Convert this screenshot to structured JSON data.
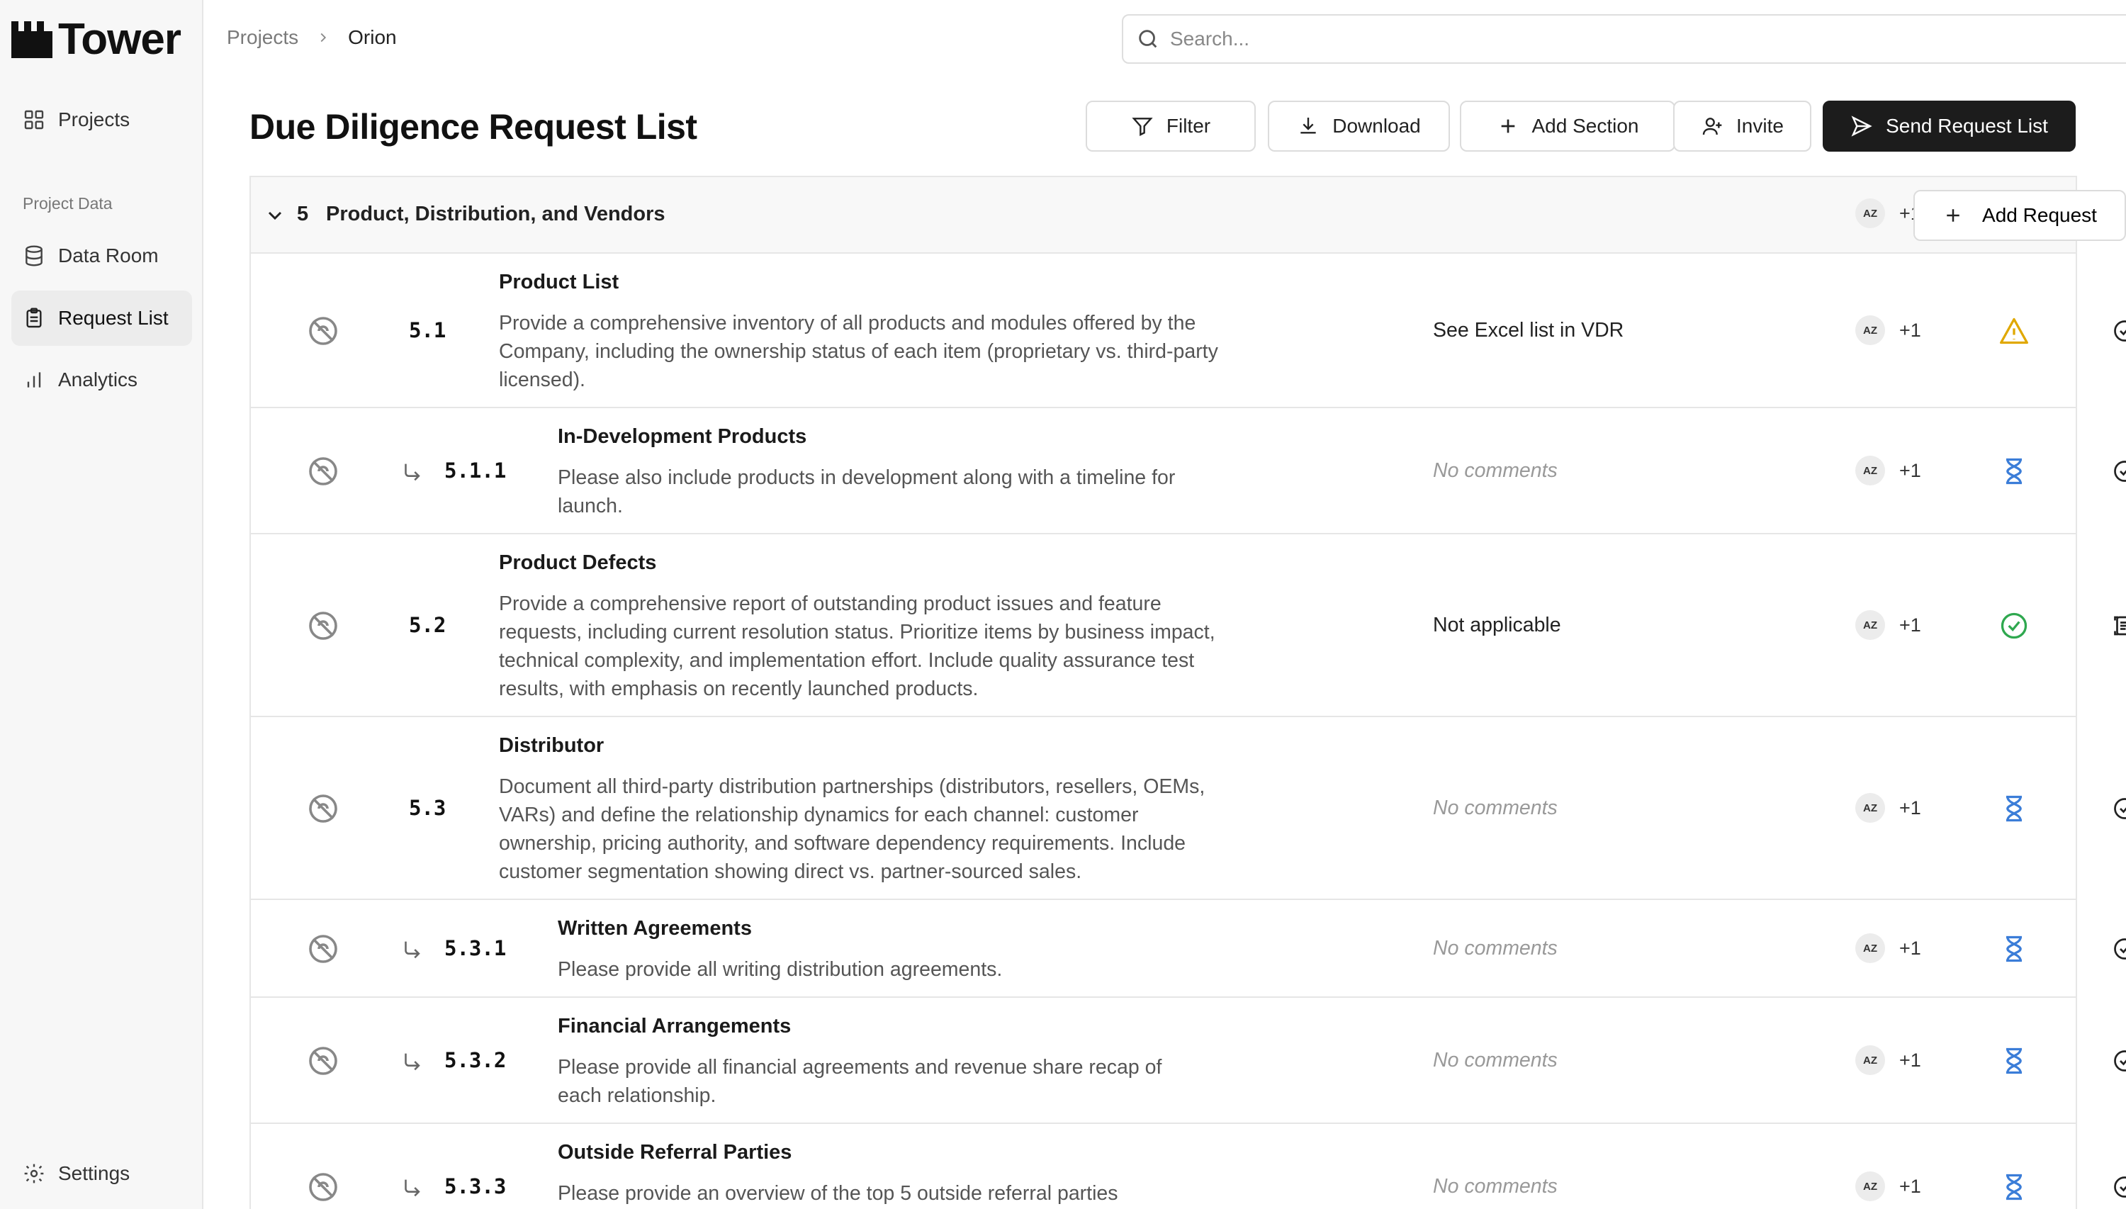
{
  "app": {
    "name": "Tower"
  },
  "sidebar": {
    "items": [
      {
        "label": "Projects",
        "icon": "grid-icon"
      },
      {
        "label": "Data Room",
        "icon": "database-icon"
      },
      {
        "label": "Request List",
        "icon": "clipboard-icon",
        "active": true
      },
      {
        "label": "Analytics",
        "icon": "bar-chart-icon"
      }
    ],
    "section_label": "Project Data",
    "settings_label": "Settings"
  },
  "breadcrumb": {
    "parent": "Projects",
    "current": "Orion"
  },
  "search": {
    "placeholder": "Search..."
  },
  "user": {
    "initials": "AZ"
  },
  "page": {
    "title": "Due Diligence Request List",
    "buttons": {
      "filter": "Filter",
      "download": "Download",
      "add_section": "Add Section",
      "invite": "Invite",
      "send": "Send Request List"
    }
  },
  "section": {
    "number": "5",
    "title": "Product, Distribution, and Vendors",
    "assignee_initials": "AZ",
    "assignee_more": "+1",
    "add_request_label": "Add Request"
  },
  "requests": [
    {
      "id": "5.1",
      "sub": false,
      "title": "Product List",
      "desc": "Provide a comprehensive inventory of all products and modules offered by the Company, including the ownership status of each item (proprietary vs. third-party licensed).",
      "comment": "See Excel list in VDR",
      "has_comment": true,
      "status": "warning",
      "action_icon": "check-circle-icon",
      "assignee": "AZ",
      "more": "+1"
    },
    {
      "id": "5.1.1",
      "sub": true,
      "title": "In-Development Products",
      "desc": "Please also include products in development along with a timeline for launch.",
      "comment": "No comments",
      "has_comment": false,
      "status": "pending",
      "action_icon": "check-circle-icon",
      "assignee": "AZ",
      "more": "+1"
    },
    {
      "id": "5.2",
      "sub": false,
      "title": "Product Defects",
      "desc": "Provide a comprehensive report of outstanding product issues and feature requests, including current resolution status. Prioritize items by business impact, technical complexity, and implementation effort. Include quality assurance test results, with emphasis on recently launched products.",
      "comment": "Not applicable",
      "has_comment": true,
      "status": "complete",
      "action_icon": "document-scan-icon",
      "assignee": "AZ",
      "more": "+1"
    },
    {
      "id": "5.3",
      "sub": false,
      "title": "Distributor",
      "desc": "Document all third-party distribution partnerships (distributors, resellers, OEMs, VARs) and define the relationship dynamics for each channel: customer ownership, pricing authority, and software dependency requirements. Include customer segmentation showing direct vs. partner-sourced sales.",
      "comment": "No comments",
      "has_comment": false,
      "status": "pending",
      "action_icon": "check-circle-icon",
      "assignee": "AZ",
      "more": "+1"
    },
    {
      "id": "5.3.1",
      "sub": true,
      "title": "Written Agreements",
      "desc": "Please provide all writing distribution agreements.",
      "comment": "No comments",
      "has_comment": false,
      "status": "pending",
      "action_icon": "check-circle-icon",
      "assignee": "AZ",
      "more": "+1"
    },
    {
      "id": "5.3.2",
      "sub": true,
      "title": "Financial Arrangements",
      "desc": "Please provide all financial agreements and revenue share recap of each relationship.",
      "comment": "No comments",
      "has_comment": false,
      "status": "pending",
      "action_icon": "check-circle-icon",
      "assignee": "AZ",
      "more": "+1"
    },
    {
      "id": "5.3.3",
      "sub": true,
      "title": "Outside Referral Parties",
      "desc": "Please provide an overview of the top 5 outside referral parties",
      "comment": "No comments",
      "has_comment": false,
      "status": "pending",
      "action_icon": "check-circle-icon",
      "assignee": "AZ",
      "more": "+1"
    }
  ],
  "colors": {
    "warning": "#e0a800",
    "pending": "#3b7dd8",
    "complete": "#2fa84f",
    "primary": "#1c1c1c"
  }
}
